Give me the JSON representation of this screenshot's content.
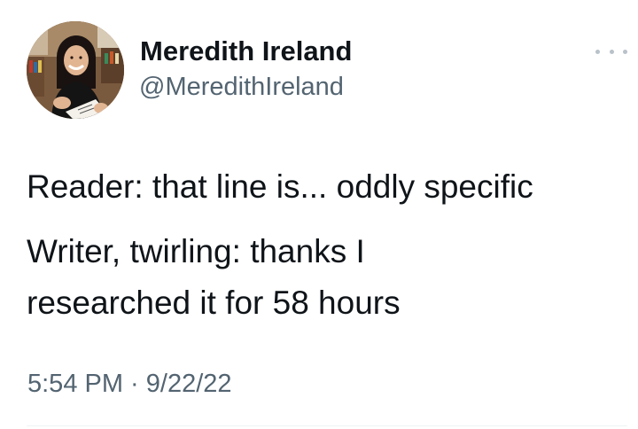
{
  "tweet": {
    "author": {
      "display_name": "Meredith Ireland",
      "handle": "@MeredithIreland",
      "avatar_icon": "profile-photo"
    },
    "more_icon": "more-horizontal-icon",
    "text_lines": [
      "Reader: that line is... oddly specific",
      "Writer, twirling: thanks I",
      "researched it for 58 hours"
    ],
    "timestamp": "5:54 PM · 9/22/22"
  },
  "colors": {
    "primary_text": "#0f1419",
    "secondary_text": "#536471",
    "dots": "#b9c2c9",
    "divider": "#eff3f4"
  }
}
